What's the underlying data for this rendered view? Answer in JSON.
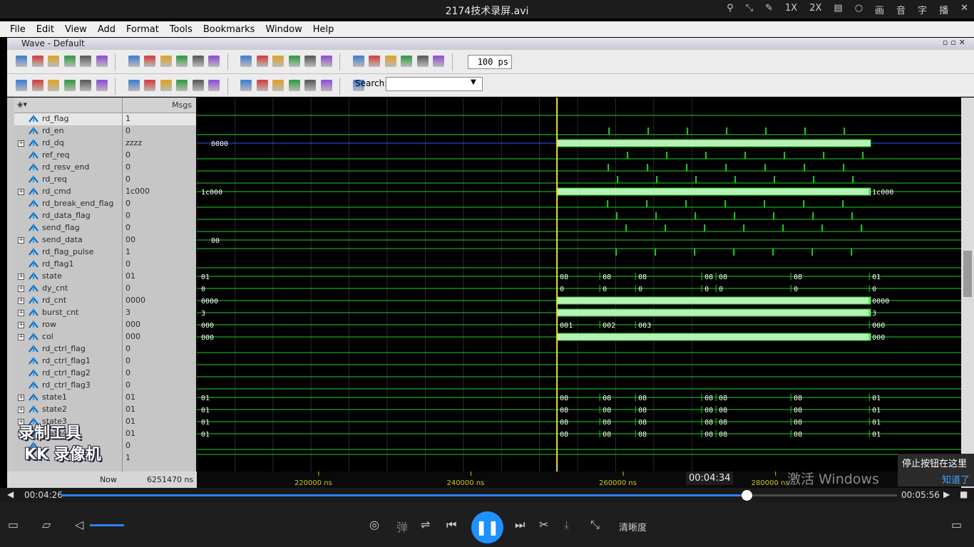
{
  "player": {
    "title": "2174技术录屏.avi",
    "top_icons": [
      "1X",
      "2X",
      "画",
      "音",
      "字",
      "播"
    ],
    "current_time": "00:04:26",
    "total_time": "00:05:56",
    "hover_time": "00:04:34",
    "progress": 0.82,
    "quality_label": "清晰度",
    "danmaku_label": "弹",
    "tooltip_text": "停止按钮在这里",
    "tooltip_link": "知道了",
    "activate_windows": "激活 Windows"
  },
  "watermark": {
    "line1": "录制工具",
    "line2": "KK 录像机"
  },
  "menu": [
    "File",
    "Edit",
    "View",
    "Add",
    "Format",
    "Tools",
    "Bookmarks",
    "Window",
    "Help"
  ],
  "wave_window": {
    "title": "Wave - Default",
    "time_step": "100",
    "time_unit": "ps",
    "search_label": "Search:",
    "msgs_header": "Msgs",
    "now_label": "Now",
    "now_value": "6251470 ns",
    "time_ticks": [
      {
        "time": 220000,
        "label": "220000 ns"
      },
      {
        "time": 240000,
        "label": "240000 ns"
      },
      {
        "time": 260000,
        "label": "260000 ns"
      },
      {
        "time": 280000,
        "label": "280000 ns"
      }
    ],
    "cursor_time": 251300,
    "signals": [
      {
        "name": "rd_flag",
        "value": "1",
        "bus": false
      },
      {
        "name": "rd_en",
        "value": "0",
        "bus": false
      },
      {
        "name": "rd_dq",
        "value": "zzzz",
        "bus": true
      },
      {
        "name": "ref_req",
        "value": "0",
        "bus": false
      },
      {
        "name": "rd_resv_end",
        "value": "0",
        "bus": false
      },
      {
        "name": "rd_req",
        "value": "0",
        "bus": false
      },
      {
        "name": "rd_cmd",
        "value": "1c000",
        "bus": true
      },
      {
        "name": "rd_break_end_flag",
        "value": "0",
        "bus": false
      },
      {
        "name": "rd_data_flag",
        "value": "0",
        "bus": false
      },
      {
        "name": "send_flag",
        "value": "0",
        "bus": false
      },
      {
        "name": "send_data",
        "value": "00",
        "bus": true
      },
      {
        "name": "rd_flag_pulse",
        "value": "1",
        "bus": false
      },
      {
        "name": "rd_flag1",
        "value": "0",
        "bus": false
      },
      {
        "name": "state",
        "value": "01",
        "bus": true
      },
      {
        "name": "dy_cnt",
        "value": "0",
        "bus": true
      },
      {
        "name": "rd_cnt",
        "value": "0000",
        "bus": true
      },
      {
        "name": "burst_cnt",
        "value": "3",
        "bus": true
      },
      {
        "name": "row",
        "value": "000",
        "bus": true
      },
      {
        "name": "col",
        "value": "000",
        "bus": true
      },
      {
        "name": "rd_ctrl_flag",
        "value": "0",
        "bus": false
      },
      {
        "name": "rd_ctrl_flag1",
        "value": "0",
        "bus": false
      },
      {
        "name": "rd_ctrl_flag2",
        "value": "0",
        "bus": false
      },
      {
        "name": "rd_ctrl_flag3",
        "value": "0",
        "bus": false
      },
      {
        "name": "state1",
        "value": "01",
        "bus": true
      },
      {
        "name": "state2",
        "value": "01",
        "bus": true
      },
      {
        "name": "state3",
        "value": "01",
        "bus": true
      },
      {
        "name": "state4",
        "value": "01",
        "bus": true
      },
      {
        "name": "",
        "value": "0",
        "bus": false
      },
      {
        "name": "",
        "value": "1",
        "bus": false
      }
    ],
    "bus_labels": [
      {
        "row": 2,
        "items": [
          "0000"
        ]
      },
      {
        "row": 6,
        "items": [
          "1c000",
          "1c000"
        ]
      },
      {
        "row": 10,
        "items": [
          "00"
        ]
      },
      {
        "row": 13,
        "items": [
          "01",
          "08",
          "08",
          "08",
          "08",
          "08",
          "08",
          "01"
        ]
      },
      {
        "row": 14,
        "items": [
          "0",
          "0",
          "0",
          "0",
          "0",
          "0",
          "0",
          "0"
        ]
      },
      {
        "row": 15,
        "items": [
          "0000",
          "0000"
        ]
      },
      {
        "row": 16,
        "items": [
          "3",
          "3"
        ]
      },
      {
        "row": 17,
        "items": [
          "000",
          "001",
          "002",
          "003",
          "000"
        ]
      },
      {
        "row": 18,
        "items": [
          "000",
          "000"
        ]
      },
      {
        "row": 23,
        "items": [
          "01",
          "08",
          "08",
          "08",
          "08",
          "08",
          "08",
          "01"
        ]
      },
      {
        "row": 24,
        "items": [
          "01",
          "08",
          "08",
          "08",
          "08",
          "08",
          "08",
          "01"
        ]
      },
      {
        "row": 25,
        "items": [
          "01",
          "08",
          "08",
          "08",
          "08",
          "08",
          "08",
          "01"
        ]
      },
      {
        "row": 26,
        "items": [
          "01",
          "08",
          "08",
          "08",
          "08",
          "08",
          "08",
          "01"
        ]
      }
    ]
  },
  "colors": {
    "wave": "#1fd11f",
    "bus_fill": "#b8f0b8",
    "cursor": "#f0e040",
    "accent": "#1e90ff",
    "bus_z": "#3050ff"
  }
}
